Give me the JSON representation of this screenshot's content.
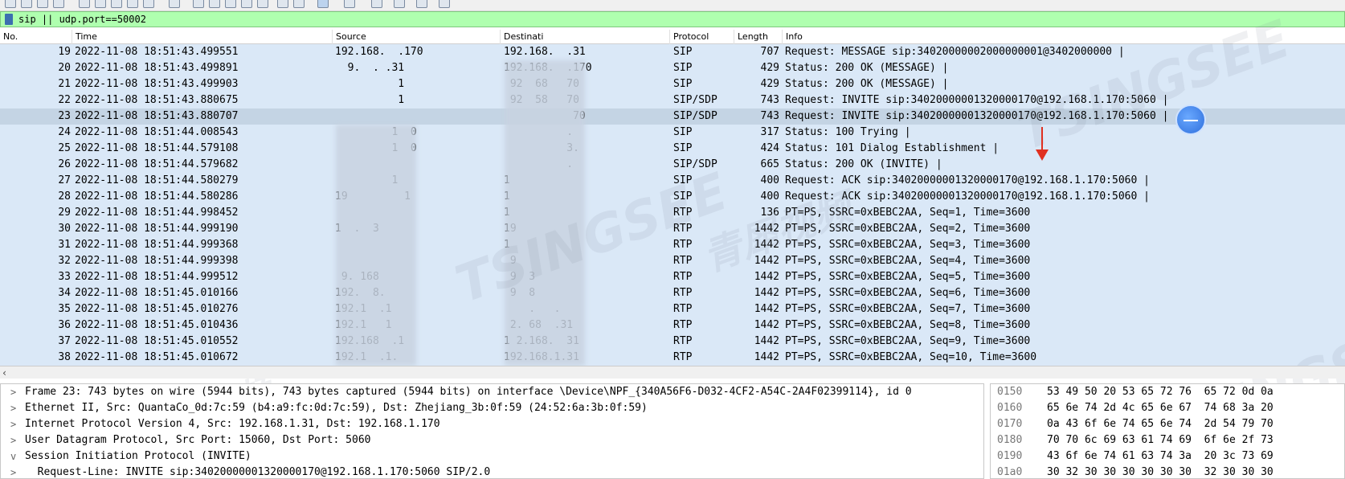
{
  "filter": {
    "text": "sip || udp.port==50002"
  },
  "columns": {
    "no": "No.",
    "time": "Time",
    "source": "Source",
    "destination": "Destinati",
    "protocol": "Protocol",
    "length": "Length",
    "info": "Info"
  },
  "packets": [
    {
      "no": "19",
      "time": "2022-11-08 18:51:43.499551",
      "src": "192.168.  .170",
      "dst": "192.168.  .31",
      "proto": "SIP",
      "len": "707",
      "info": "Request: MESSAGE sip:34020000002000000001@3402000000 |"
    },
    {
      "no": "20",
      "time": "2022-11-08 18:51:43.499891",
      "src": "  9.  . .31",
      "dst": "192.168.  .170",
      "proto": "SIP",
      "len": "429",
      "info": "Status: 200 OK (MESSAGE) |"
    },
    {
      "no": "21",
      "time": "2022-11-08 18:51:43.499903",
      "src": "          1",
      "dst": " 92  68   70",
      "proto": "SIP",
      "len": "429",
      "info": "Status: 200 OK (MESSAGE) |"
    },
    {
      "no": "22",
      "time": "2022-11-08 18:51:43.880675",
      "src": "          1",
      "dst": " 92  58   70",
      "proto": "SIP/SDP",
      "len": "743",
      "info": "Request: INVITE sip:34020000001320000170@192.168.1.170:5060 |"
    },
    {
      "no": "23",
      "time": "2022-11-08 18:51:43.880707",
      "src": "",
      "dst": "           70",
      "proto": "SIP/SDP",
      "len": "743",
      "info": "Request: INVITE sip:34020000001320000170@192.168.1.170:5060 |"
    },
    {
      "no": "24",
      "time": "2022-11-08 18:51:44.008543",
      "src": "         1  0",
      "dst": "          .",
      "proto": "SIP",
      "len": "317",
      "info": "Status: 100 Trying |"
    },
    {
      "no": "25",
      "time": "2022-11-08 18:51:44.579108",
      "src": "         1  0",
      "dst": "          3.",
      "proto": "SIP",
      "len": "424",
      "info": "Status: 101 Dialog Establishment |"
    },
    {
      "no": "26",
      "time": "2022-11-08 18:51:44.579682",
      "src": "",
      "dst": "          .",
      "proto": "SIP/SDP",
      "len": "665",
      "info": "Status: 200 OK (INVITE) |"
    },
    {
      "no": "27",
      "time": "2022-11-08 18:51:44.580279",
      "src": "         1",
      "dst": "1",
      "proto": "SIP",
      "len": "400",
      "info": "Request: ACK sip:34020000001320000170@192.168.1.170:5060 |"
    },
    {
      "no": "28",
      "time": "2022-11-08 18:51:44.580286",
      "src": "19         1",
      "dst": "1",
      "proto": "SIP",
      "len": "400",
      "info": "Request: ACK sip:34020000001320000170@192.168.1.170:5060 |"
    },
    {
      "no": "29",
      "time": "2022-11-08 18:51:44.998452",
      "src": "",
      "dst": "1",
      "proto": "RTP",
      "len": "136",
      "info": "PT=PS, SSRC=0xBEBC2AA, Seq=1, Time=3600"
    },
    {
      "no": "30",
      "time": "2022-11-08 18:51:44.999190",
      "src": "1  .  3",
      "dst": "19",
      "proto": "RTP",
      "len": "1442",
      "info": "PT=PS, SSRC=0xBEBC2AA, Seq=2, Time=3600"
    },
    {
      "no": "31",
      "time": "2022-11-08 18:51:44.999368",
      "src": "",
      "dst": "1",
      "proto": "RTP",
      "len": "1442",
      "info": "PT=PS, SSRC=0xBEBC2AA, Seq=3, Time=3600"
    },
    {
      "no": "32",
      "time": "2022-11-08 18:51:44.999398",
      "src": "",
      "dst": " 9",
      "proto": "RTP",
      "len": "1442",
      "info": "PT=PS, SSRC=0xBEBC2AA, Seq=4, Time=3600"
    },
    {
      "no": "33",
      "time": "2022-11-08 18:51:44.999512",
      "src": " 9. 168",
      "dst": " 9  3",
      "proto": "RTP",
      "len": "1442",
      "info": "PT=PS, SSRC=0xBEBC2AA, Seq=5, Time=3600"
    },
    {
      "no": "34",
      "time": "2022-11-08 18:51:45.010166",
      "src": "192.  8.",
      "dst": " 9  8",
      "proto": "RTP",
      "len": "1442",
      "info": "PT=PS, SSRC=0xBEBC2AA, Seq=6, Time=3600"
    },
    {
      "no": "35",
      "time": "2022-11-08 18:51:45.010276",
      "src": "192.1  .1",
      "dst": "    .   .",
      "proto": "RTP",
      "len": "1442",
      "info": "PT=PS, SSRC=0xBEBC2AA, Seq=7, Time=3600"
    },
    {
      "no": "36",
      "time": "2022-11-08 18:51:45.010436",
      "src": "192.1   1",
      "dst": " 2. 68  .31",
      "proto": "RTP",
      "len": "1442",
      "info": "PT=PS, SSRC=0xBEBC2AA, Seq=8, Time=3600"
    },
    {
      "no": "37",
      "time": "2022-11-08 18:51:45.010552",
      "src": "192.168  .1",
      "dst": "1 2.168.  31",
      "proto": "RTP",
      "len": "1442",
      "info": "PT=PS, SSRC=0xBEBC2AA, Seq=9, Time=3600"
    },
    {
      "no": "38",
      "time": "2022-11-08 18:51:45.010672",
      "src": "192.1  .1.",
      "dst": "192.168.1.31",
      "proto": "RTP",
      "len": "1442",
      "info": "PT=PS, SSRC=0xBEBC2AA, Seq=10, Time=3600"
    }
  ],
  "selected_row": "23",
  "details": [
    {
      "exp": ">",
      "text": "Frame 23: 743 bytes on wire (5944 bits), 743 bytes captured (5944 bits) on interface \\Device\\NPF_{340A56F6-D032-4CF2-A54C-2A4F02399114}, id 0"
    },
    {
      "exp": ">",
      "text": "Ethernet II, Src: QuantaCo_0d:7c:59 (b4:a9:fc:0d:7c:59), Dst: Zhejiang_3b:0f:59 (24:52:6a:3b:0f:59)"
    },
    {
      "exp": ">",
      "text": "Internet Protocol Version 4, Src: 192.168.1.31, Dst: 192.168.1.170"
    },
    {
      "exp": ">",
      "text": "User Datagram Protocol, Src Port: 15060, Dst Port: 5060"
    },
    {
      "exp": "v",
      "text": "Session Initiation Protocol (INVITE)"
    },
    {
      "exp": ">",
      "text": "  Request-Line: INVITE sip:34020000001320000170@192.168.1.170:5060 SIP/2.0"
    }
  ],
  "hex": [
    {
      "off": "0150",
      "bytes": "53 49 50 20 53 65 72 76  65 72 0d 0a"
    },
    {
      "off": "0160",
      "bytes": "65 6e 74 2d 4c 65 6e 67  74 68 3a 20"
    },
    {
      "off": "0170",
      "bytes": "0a 43 6f 6e 74 65 6e 74  2d 54 79 70"
    },
    {
      "off": "0180",
      "bytes": "70 70 6c 69 63 61 74 69  6f 6e 2f 73"
    },
    {
      "off": "0190",
      "bytes": "43 6f 6e 74 61 63 74 3a  20 3c 73 69"
    },
    {
      "off": "01a0",
      "bytes": "30 32 30 30 30 30 30 30  32 30 30 30"
    }
  ],
  "watermark": {
    "text": "TSINGSEE",
    "cn_text": "青犀视频"
  },
  "colors": {
    "row_bg": "#dae8f7",
    "selected_bg": "#c4d4e4",
    "filter_bg": "#afffaf",
    "arrow": "#e03020"
  },
  "icons": [
    "toolbar-icons",
    "bookmark-icon",
    "expand-arrow-icon",
    "cursor-badge-icon"
  ]
}
